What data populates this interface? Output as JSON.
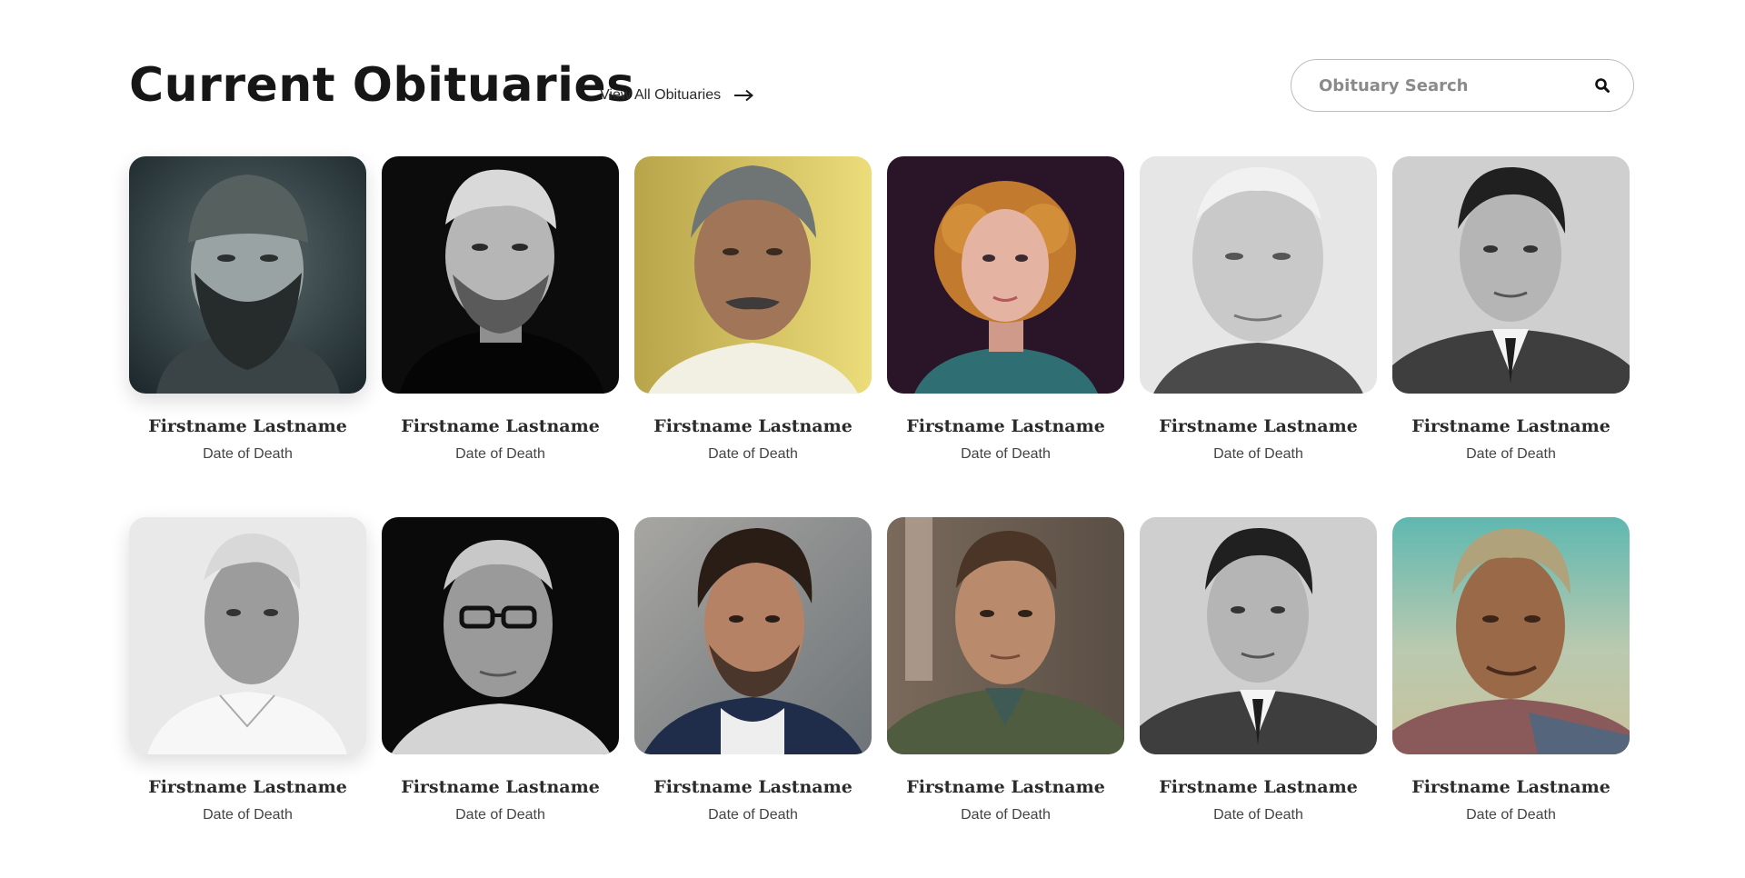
{
  "header": {
    "title": "Current Obituaries",
    "view_all_label": "View All Obituaries"
  },
  "search": {
    "placeholder": "Obituary Search",
    "value": ""
  },
  "obituaries": [
    {
      "name": "Firstname Lastname",
      "date": "Date of Death",
      "photo": "bearded-man-beanie-bw"
    },
    {
      "name": "Firstname Lastname",
      "date": "Date of Death",
      "photo": "man-black-tshirt-bw"
    },
    {
      "name": "Firstname Lastname",
      "date": "Date of Death",
      "photo": "older-man-mustache-yellow-bg"
    },
    {
      "name": "Firstname Lastname",
      "date": "Date of Death",
      "photo": "woman-curly-red-hair"
    },
    {
      "name": "Firstname Lastname",
      "date": "Date of Death",
      "photo": "elderly-man-bw"
    },
    {
      "name": "Firstname Lastname",
      "date": "Date of Death",
      "photo": "man-suit-bw"
    },
    {
      "name": "Firstname Lastname",
      "date": "Date of Death",
      "photo": "elderly-man-white-shirt-bw"
    },
    {
      "name": "Firstname Lastname",
      "date": "Date of Death",
      "photo": "elderly-man-glasses-bw"
    },
    {
      "name": "Firstname Lastname",
      "date": "Date of Death",
      "photo": "man-dark-hair-beard"
    },
    {
      "name": "Firstname Lastname",
      "date": "Date of Death",
      "photo": "man-green-jacket"
    },
    {
      "name": "Firstname Lastname",
      "date": "Date of Death",
      "photo": "man-suit-bw"
    },
    {
      "name": "Firstname Lastname",
      "date": "Date of Death",
      "photo": "weathered-man-outdoors"
    }
  ],
  "colors": {
    "title": "#161616",
    "search_border": "#bdbdbd",
    "placeholder": "#8a8a8a"
  }
}
